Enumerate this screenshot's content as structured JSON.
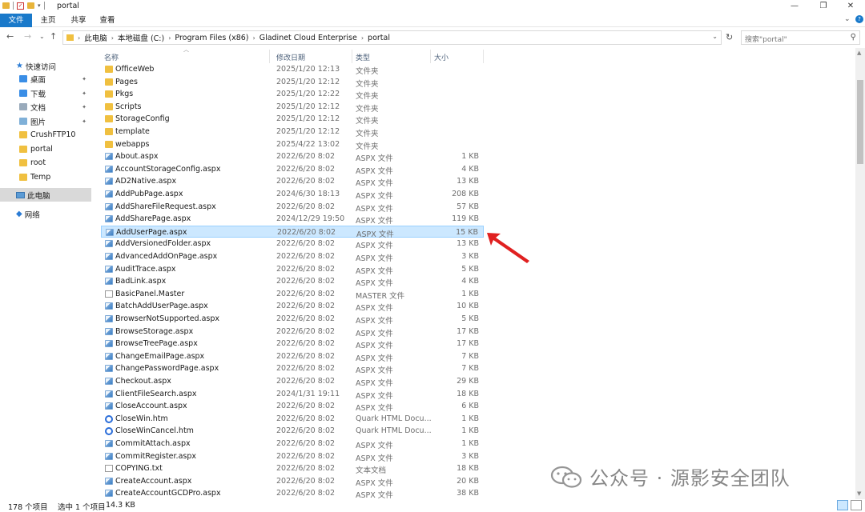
{
  "window": {
    "title": "portal"
  },
  "window_controls": {
    "minimize": "—",
    "maximize": "❐",
    "close": "✕"
  },
  "ribbon": {
    "tabs": [
      "文件",
      "主页",
      "共享",
      "查看"
    ],
    "collapse_glyph": "⌄",
    "help_glyph": "?"
  },
  "nav": {
    "back": "←",
    "forward": "→",
    "recent": "⌄",
    "up": "↑",
    "refresh": "↻"
  },
  "address": {
    "crumbs": [
      "此电脑",
      "本地磁盘 (C:)",
      "Program Files (x86)",
      "Gladinet Cloud Enterprise",
      "portal"
    ],
    "separator": "›",
    "dropdown_glyph": "⌄"
  },
  "search": {
    "placeholder": "搜索\"portal\"",
    "icon": "search-icon"
  },
  "sidebar": {
    "quick_access": "快速访问",
    "items": [
      {
        "label": "桌面",
        "pinned": true
      },
      {
        "label": "下载",
        "pinned": true
      },
      {
        "label": "文档",
        "pinned": true
      },
      {
        "label": "图片",
        "pinned": true
      },
      {
        "label": "CrushFTP10",
        "pinned": false
      },
      {
        "label": "portal",
        "pinned": false
      },
      {
        "label": "root",
        "pinned": false
      },
      {
        "label": "Temp",
        "pinned": false
      }
    ],
    "this_pc": "此电脑",
    "network": "网络",
    "pin_glyph": "📌"
  },
  "columns": {
    "name": "名称",
    "date": "修改日期",
    "type": "类型",
    "size": "大小"
  },
  "files": [
    {
      "name": "OfficeWeb",
      "date": "2025/1/20 12:13",
      "type": "文件夹",
      "size": "",
      "icon": "folder"
    },
    {
      "name": "Pages",
      "date": "2025/1/20 12:12",
      "type": "文件夹",
      "size": "",
      "icon": "folder"
    },
    {
      "name": "Pkgs",
      "date": "2025/1/20 12:22",
      "type": "文件夹",
      "size": "",
      "icon": "folder"
    },
    {
      "name": "Scripts",
      "date": "2025/1/20 12:12",
      "type": "文件夹",
      "size": "",
      "icon": "folder"
    },
    {
      "name": "StorageConfig",
      "date": "2025/1/20 12:12",
      "type": "文件夹",
      "size": "",
      "icon": "folder"
    },
    {
      "name": "template",
      "date": "2025/1/20 12:12",
      "type": "文件夹",
      "size": "",
      "icon": "folder"
    },
    {
      "name": "webapps",
      "date": "2025/4/22 13:02",
      "type": "文件夹",
      "size": "",
      "icon": "folder"
    },
    {
      "name": "About.aspx",
      "date": "2022/6/20 8:02",
      "type": "ASPX 文件",
      "size": "1 KB",
      "icon": "aspx"
    },
    {
      "name": "AccountStorageConfig.aspx",
      "date": "2022/6/20 8:02",
      "type": "ASPX 文件",
      "size": "4 KB",
      "icon": "aspx"
    },
    {
      "name": "AD2Native.aspx",
      "date": "2022/6/20 8:02",
      "type": "ASPX 文件",
      "size": "13 KB",
      "icon": "aspx"
    },
    {
      "name": "AddPubPage.aspx",
      "date": "2024/6/30 18:13",
      "type": "ASPX 文件",
      "size": "208 KB",
      "icon": "aspx"
    },
    {
      "name": "AddShareFileRequest.aspx",
      "date": "2022/6/20 8:02",
      "type": "ASPX 文件",
      "size": "57 KB",
      "icon": "aspx"
    },
    {
      "name": "AddSharePage.aspx",
      "date": "2024/12/29 19:50",
      "type": "ASPX 文件",
      "size": "119 KB",
      "icon": "aspx"
    },
    {
      "name": "AddUserPage.aspx",
      "date": "2022/6/20 8:02",
      "type": "ASPX 文件",
      "size": "15 KB",
      "icon": "aspx",
      "selected": true
    },
    {
      "name": "AddVersionedFolder.aspx",
      "date": "2022/6/20 8:02",
      "type": "ASPX 文件",
      "size": "13 KB",
      "icon": "aspx"
    },
    {
      "name": "AdvancedAddOnPage.aspx",
      "date": "2022/6/20 8:02",
      "type": "ASPX 文件",
      "size": "3 KB",
      "icon": "aspx"
    },
    {
      "name": "AuditTrace.aspx",
      "date": "2022/6/20 8:02",
      "type": "ASPX 文件",
      "size": "5 KB",
      "icon": "aspx"
    },
    {
      "name": "BadLink.aspx",
      "date": "2022/6/20 8:02",
      "type": "ASPX 文件",
      "size": "4 KB",
      "icon": "aspx"
    },
    {
      "name": "BasicPanel.Master",
      "date": "2022/6/20 8:02",
      "type": "MASTER 文件",
      "size": "1 KB",
      "icon": "doc"
    },
    {
      "name": "BatchAddUserPage.aspx",
      "date": "2022/6/20 8:02",
      "type": "ASPX 文件",
      "size": "10 KB",
      "icon": "aspx"
    },
    {
      "name": "BrowserNotSupported.aspx",
      "date": "2022/6/20 8:02",
      "type": "ASPX 文件",
      "size": "5 KB",
      "icon": "aspx"
    },
    {
      "name": "BrowseStorage.aspx",
      "date": "2022/6/20 8:02",
      "type": "ASPX 文件",
      "size": "17 KB",
      "icon": "aspx"
    },
    {
      "name": "BrowseTreePage.aspx",
      "date": "2022/6/20 8:02",
      "type": "ASPX 文件",
      "size": "17 KB",
      "icon": "aspx"
    },
    {
      "name": "ChangeEmailPage.aspx",
      "date": "2022/6/20 8:02",
      "type": "ASPX 文件",
      "size": "7 KB",
      "icon": "aspx"
    },
    {
      "name": "ChangePasswordPage.aspx",
      "date": "2022/6/20 8:02",
      "type": "ASPX 文件",
      "size": "7 KB",
      "icon": "aspx"
    },
    {
      "name": "Checkout.aspx",
      "date": "2022/6/20 8:02",
      "type": "ASPX 文件",
      "size": "29 KB",
      "icon": "aspx"
    },
    {
      "name": "ClientFileSearch.aspx",
      "date": "2024/1/31 19:11",
      "type": "ASPX 文件",
      "size": "18 KB",
      "icon": "aspx"
    },
    {
      "name": "CloseAccount.aspx",
      "date": "2022/6/20 8:02",
      "type": "ASPX 文件",
      "size": "6 KB",
      "icon": "aspx"
    },
    {
      "name": "CloseWin.htm",
      "date": "2022/6/20 8:02",
      "type": "Quark HTML Docu...",
      "size": "1 KB",
      "icon": "htm"
    },
    {
      "name": "CloseWinCancel.htm",
      "date": "2022/6/20 8:02",
      "type": "Quark HTML Docu...",
      "size": "1 KB",
      "icon": "htm"
    },
    {
      "name": "CommitAttach.aspx",
      "date": "2022/6/20 8:02",
      "type": "ASPX 文件",
      "size": "1 KB",
      "icon": "aspx"
    },
    {
      "name": "CommitRegister.aspx",
      "date": "2022/6/20 8:02",
      "type": "ASPX 文件",
      "size": "3 KB",
      "icon": "aspx"
    },
    {
      "name": "COPYING.txt",
      "date": "2022/6/20 8:02",
      "type": "文本文档",
      "size": "18 KB",
      "icon": "doc"
    },
    {
      "name": "CreateAccount.aspx",
      "date": "2022/6/20 8:02",
      "type": "ASPX 文件",
      "size": "20 KB",
      "icon": "aspx"
    },
    {
      "name": "CreateAccountGCDPro.aspx",
      "date": "2022/6/20 8:02",
      "type": "ASPX 文件",
      "size": "38 KB",
      "icon": "aspx"
    }
  ],
  "status": {
    "count": "178 个项目",
    "selected": "选中 1 个项目",
    "size": "14.3 KB"
  },
  "watermark": {
    "text": "公众号 · 源影安全团队"
  },
  "colors": {
    "accent": "#1979ca",
    "selection": "#cce8ff",
    "annotation": "#e02020"
  }
}
